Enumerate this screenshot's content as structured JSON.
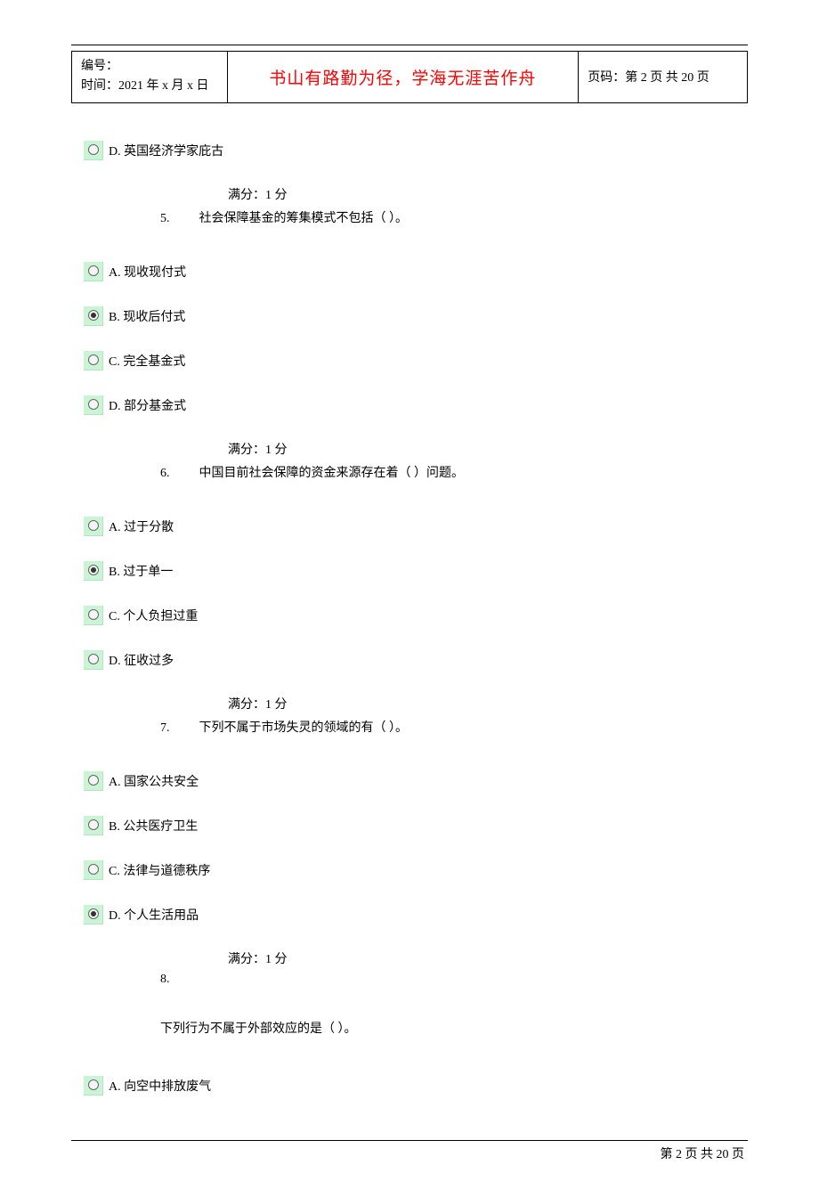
{
  "header": {
    "left_line1": "编号：",
    "left_line2": "时间：2021 年 x 月 x 日",
    "center": "书山有路勤为径，学海无涯苦作舟",
    "right": "页码：第 2 页  共 20 页"
  },
  "orphan_option": {
    "label": "D.  英国经济学家庇古",
    "selected": false
  },
  "questions": [
    {
      "number": "5.",
      "score": "满分：1      分",
      "text": "社会保障基金的筹集模式不包括（     ）。",
      "options": [
        {
          "label": "A.  现收现付式",
          "selected": false
        },
        {
          "label": "B.  现收后付式",
          "selected": true
        },
        {
          "label": "C.  完全基金式",
          "selected": false
        },
        {
          "label": "D.  部分基金式",
          "selected": false
        }
      ]
    },
    {
      "number": "6.",
      "score": "满分：1      分",
      "text": "中国目前社会保障的资金来源存在着（     ）问题。",
      "options": [
        {
          "label": "A.  过于分散",
          "selected": false
        },
        {
          "label": "B.  过于单一",
          "selected": true
        },
        {
          "label": "C.  个人负担过重",
          "selected": false
        },
        {
          "label": "D.  征收过多",
          "selected": false
        }
      ]
    },
    {
      "number": "7.",
      "score": "满分：1      分",
      "text": "下列不属于市场失灵的领域的有（     ）。",
      "options": [
        {
          "label": "A.  国家公共安全",
          "selected": false
        },
        {
          "label": "B.  公共医疗卫生",
          "selected": false
        },
        {
          "label": "C.  法律与道德秩序",
          "selected": false
        },
        {
          "label": "D.  个人生活用品",
          "selected": true
        }
      ]
    },
    {
      "number": "8.",
      "score": "满分：1      分",
      "text": "下列行为不属于外部效应的是（      ）。",
      "options": [
        {
          "label": "A.  向空中排放废气",
          "selected": false
        }
      ]
    }
  ],
  "footer": "第  2  页  共  20  页"
}
